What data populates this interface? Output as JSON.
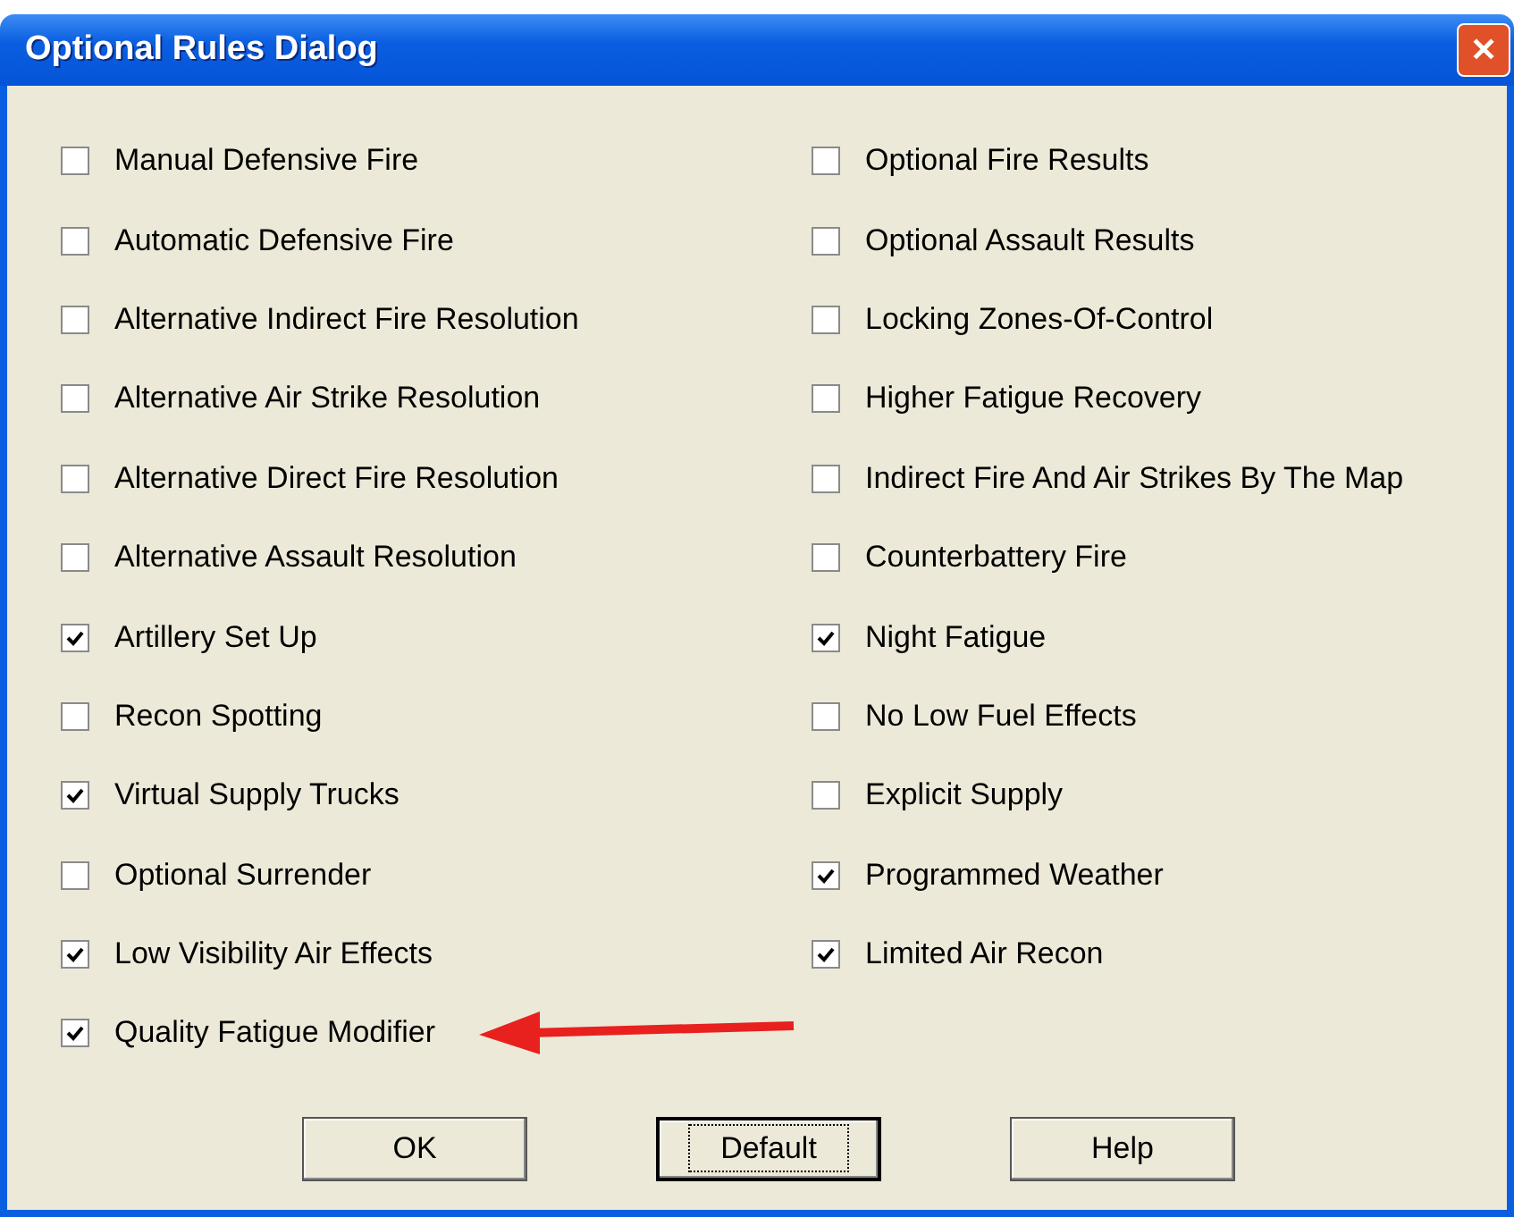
{
  "window": {
    "title": "Optional Rules Dialog",
    "close": "✕"
  },
  "left_options": [
    {
      "label": "Manual Defensive Fire",
      "checked": false
    },
    {
      "label": "Automatic Defensive Fire",
      "checked": false
    },
    {
      "label": "Alternative Indirect Fire Resolution",
      "checked": false
    },
    {
      "label": "Alternative Air Strike Resolution",
      "checked": false
    },
    {
      "label": "Alternative Direct Fire Resolution",
      "checked": false
    },
    {
      "label": "Alternative Assault Resolution",
      "checked": false
    },
    {
      "label": "Artillery Set Up",
      "checked": true
    },
    {
      "label": "Recon Spotting",
      "checked": false
    },
    {
      "label": "Virtual Supply Trucks",
      "checked": true
    },
    {
      "label": "Optional Surrender",
      "checked": false
    },
    {
      "label": "Low Visibility Air Effects",
      "checked": true
    },
    {
      "label": "Quality Fatigue Modifier",
      "checked": true
    }
  ],
  "right_options": [
    {
      "label": "Optional Fire Results",
      "checked": false
    },
    {
      "label": "Optional Assault Results",
      "checked": false
    },
    {
      "label": "Locking Zones-Of-Control",
      "checked": false
    },
    {
      "label": "Higher Fatigue Recovery",
      "checked": false
    },
    {
      "label": "Indirect Fire And Air Strikes By The Map",
      "checked": false
    },
    {
      "label": "Counterbattery Fire",
      "checked": false
    },
    {
      "label": "Night Fatigue",
      "checked": true
    },
    {
      "label": "No Low Fuel Effects",
      "checked": false
    },
    {
      "label": "Explicit Supply",
      "checked": false
    },
    {
      "label": "Programmed Weather",
      "checked": true
    },
    {
      "label": "Limited Air Recon",
      "checked": true
    }
  ],
  "buttons": [
    {
      "label": "OK",
      "focused": false
    },
    {
      "label": "Default",
      "focused": true
    },
    {
      "label": "Help",
      "focused": false
    }
  ]
}
